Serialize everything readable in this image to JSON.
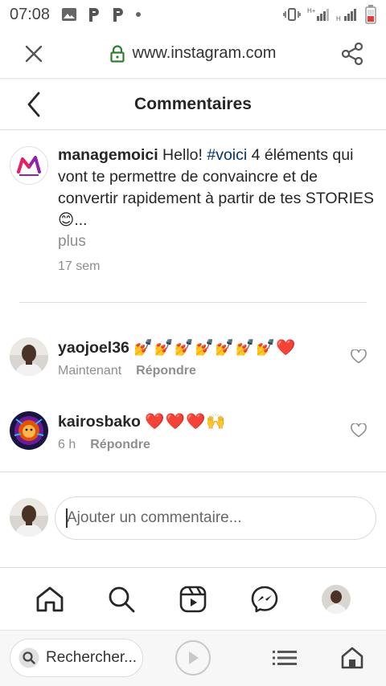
{
  "status_bar": {
    "time": "07:08",
    "left_icons": [
      "image-icon",
      "p-app-icon",
      "p-app-icon",
      "dot-icon"
    ],
    "right_icons": [
      "vibrate-icon",
      "signal-h-plus-icon",
      "signal-h-icon",
      "battery-icon"
    ]
  },
  "browser": {
    "url": "www.instagram.com",
    "search_placeholder": "Rechercher..."
  },
  "header": {
    "title": "Commentaires"
  },
  "caption": {
    "username": "managemoici",
    "text_before_hashtag": " Hello! ",
    "hashtag": "#voici",
    "text_after_hashtag": " 4 éléments qui vont te permettre de convaincre et de convertir rapidement à partir de tes STORIES😊...",
    "more_label": "plus",
    "time": "17 sem"
  },
  "comments": [
    {
      "username": "yaojoel36",
      "text": "💅💅💅💅💅💅💅❤️",
      "time": "Maintenant",
      "reply_label": "Répondre"
    },
    {
      "username": "kairosbako",
      "text": "❤️❤️❤️🙌",
      "time": "6 h",
      "reply_label": "Répondre"
    }
  ],
  "add_comment": {
    "placeholder": "Ajouter un commentaire..."
  },
  "colors": {
    "hashtag": "#00376b",
    "muted": "#8e8e8e",
    "text": "#262626",
    "browser_lock": "#2e7d32"
  },
  "bottom_nav": [
    "home-icon",
    "search-icon",
    "reels-icon",
    "messenger-icon",
    "profile-avatar"
  ]
}
